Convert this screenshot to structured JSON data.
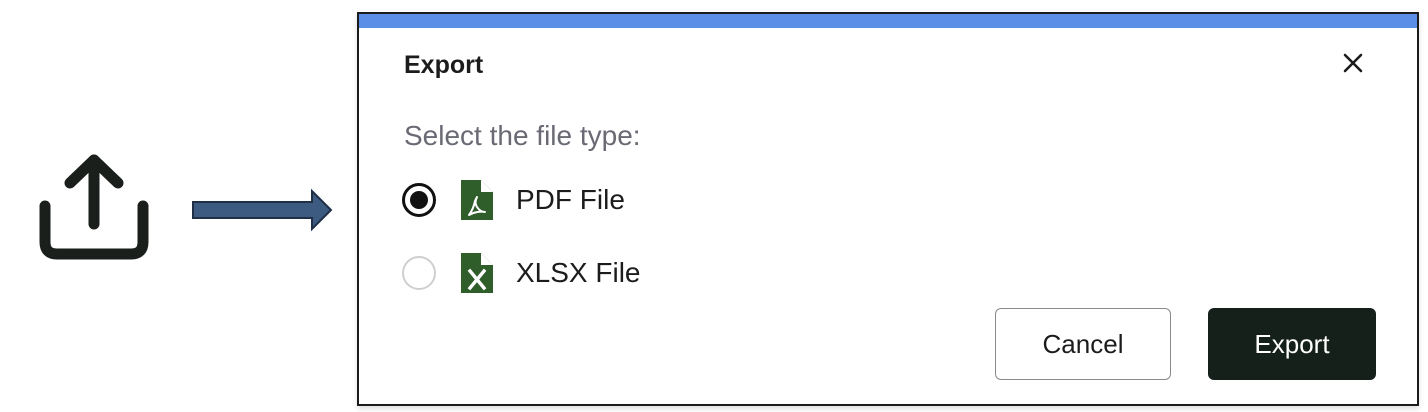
{
  "colors": {
    "accent_bar": "#5b8ee6",
    "file_icon": "#2f5e2a",
    "primary_button": "#16201a",
    "arrow_fill": "#3d5a80",
    "arrow_stroke": "#1f2f45"
  },
  "icons": {
    "share": "upload-share-icon",
    "arrow": "right-arrow-icon",
    "close": "close-icon",
    "pdf": "pdf-file-icon",
    "xlsx": "xlsx-file-icon"
  },
  "dialog": {
    "title": "Export",
    "subtitle": "Select the file type:",
    "options": [
      {
        "label": "PDF File",
        "selected": true
      },
      {
        "label": "XLSX File",
        "selected": false
      }
    ],
    "cancel_label": "Cancel",
    "export_label": "Export"
  }
}
